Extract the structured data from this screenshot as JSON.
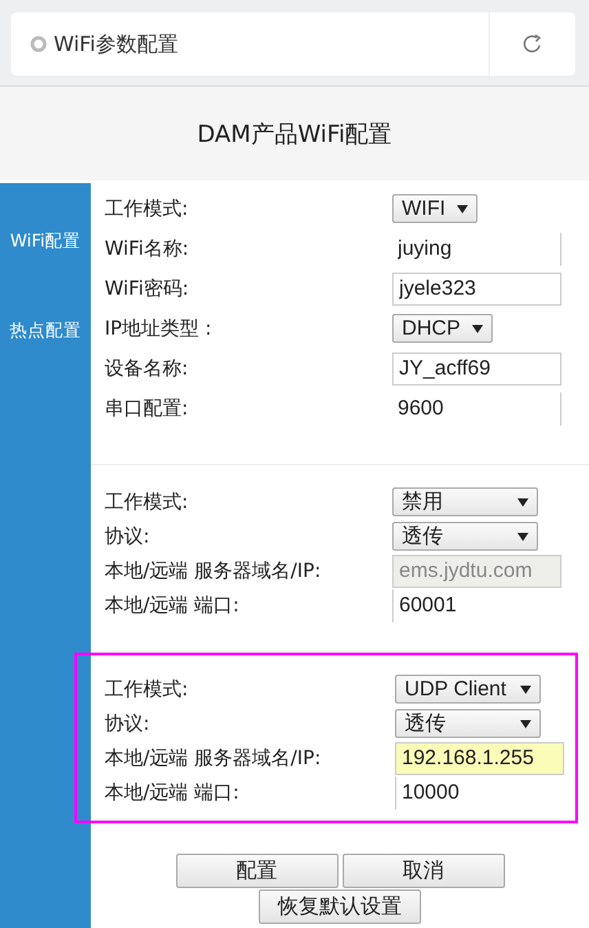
{
  "browser_bar": {
    "title": "WiFi参数配置"
  },
  "page_title": "DAM产品WiFi配置",
  "sidebar": {
    "items": [
      "WiFi配置",
      "热点配置"
    ]
  },
  "sections": [
    {
      "highlighted": false,
      "rows": [
        {
          "label": "工作模式:",
          "kind": "select",
          "value": "WIFI"
        },
        {
          "label": "WiFi名称:",
          "kind": "plain",
          "value": "juying"
        },
        {
          "label": "WiFi密码:",
          "kind": "input",
          "value": "jyele323"
        },
        {
          "label": "IP地址类型 :",
          "kind": "select",
          "value": "DHCP"
        },
        {
          "label": "设备名称:",
          "kind": "input",
          "value": "JY_acff69"
        },
        {
          "label": "串口配置:",
          "kind": "plain",
          "value": "9600"
        }
      ]
    },
    {
      "highlighted": false,
      "rows": [
        {
          "label": "工作模式:",
          "kind": "select",
          "value": "禁用"
        },
        {
          "label": "协议:",
          "kind": "select",
          "value": "透传"
        },
        {
          "label": "本地/远端 服务器域名/IP:",
          "kind": "input",
          "value": "ems.jydtu.com",
          "disabled": true
        },
        {
          "label": "本地/远端 端口:",
          "kind": "lined",
          "value": "60001"
        }
      ]
    },
    {
      "highlighted": true,
      "rows": [
        {
          "label": "工作模式:",
          "kind": "select",
          "value": "UDP Client"
        },
        {
          "label": "协议:",
          "kind": "select",
          "value": "透传"
        },
        {
          "label": "本地/远端 服务器域名/IP:",
          "kind": "input",
          "value": "192.168.1.255",
          "autofilled": true
        },
        {
          "label": "本地/远端 端口:",
          "kind": "lined",
          "value": "10000"
        }
      ]
    }
  ],
  "buttons": [
    "配置",
    "取消"
  ],
  "reset_button": "恢复默认设置"
}
